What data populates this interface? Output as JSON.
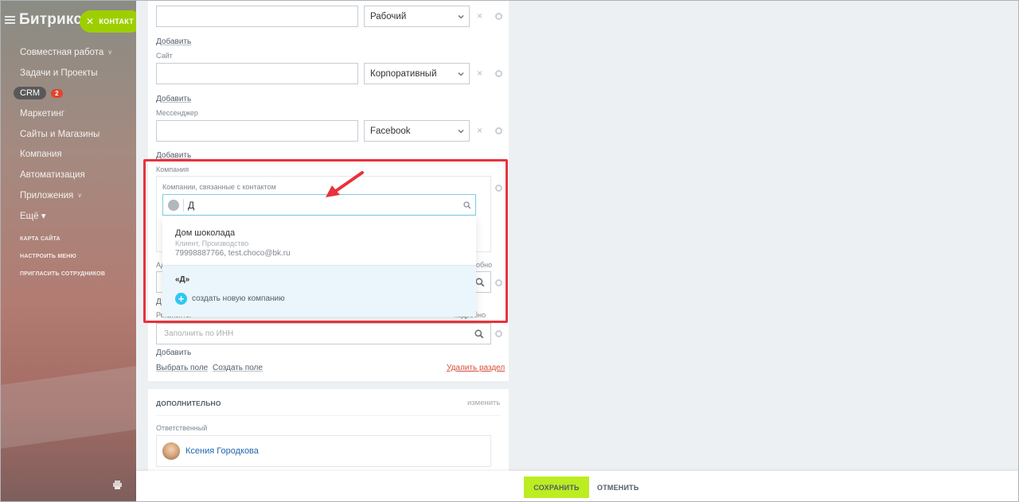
{
  "sidebar": {
    "logo": "Битрикс",
    "contact_pill": "КОНТАКТ",
    "items": [
      {
        "label": "Совместная работа",
        "chevron": true
      },
      {
        "label": "Задачи и Проекты"
      },
      {
        "label": "CRM",
        "badge": "2"
      },
      {
        "label": "Маркетинг"
      },
      {
        "label": "Сайты и Магазины"
      },
      {
        "label": "Компания"
      },
      {
        "label": "Автоматизация"
      },
      {
        "label": "Приложения",
        "chevron": true
      },
      {
        "label": "Ещё ▾"
      }
    ],
    "small_links": [
      "КАРТА САЙТА",
      "НАСТРОИТЬ МЕНЮ",
      "ПРИГЛАСИТЬ СОТРУДНИКОВ"
    ]
  },
  "form": {
    "email": {
      "type_value": "Рабочий",
      "add_link": "Добавить"
    },
    "site": {
      "label": "Сайт",
      "type_value": "Корпоративный",
      "add_link": "Добавить"
    },
    "messenger": {
      "label": "Мессенджер",
      "type_value": "Facebook",
      "add_link": "Добавить"
    },
    "company": {
      "section_label": "Компания",
      "field_label": "Компании, связанные с контактом",
      "search_value": "Д",
      "result_name": "Дом шоколада",
      "result_meta": "Клиент, Производство",
      "result_contacts": "79998887766, test.choco@bk.ru",
      "query_echo": "«Д»",
      "create_new": "создать новую компанию"
    },
    "address": {
      "label_partial": "Ад",
      "details_partial": "обно",
      "add_partial": "Д"
    },
    "requisites": {
      "label": "Реквизиты",
      "details": "подробно",
      "placeholder": "Заполнить по ИНН",
      "add_link": "Добавить"
    },
    "footer_links": {
      "choose_field": "Выбрать поле",
      "create_field": "Создать поле",
      "delete_section": "Удалить раздел"
    }
  },
  "additional": {
    "title": "ДОПОЛНИТЕЛЬНО",
    "edit_link": "изменить",
    "responsible_label": "Ответственный",
    "responsible_name": "Ксения Городкова"
  },
  "footer": {
    "save": "СОХРАНИТЬ",
    "cancel": "ОТМЕНИТЬ"
  },
  "colors": {
    "accent_green": "#bbed21",
    "highlight_red": "#e9323b",
    "link_blue": "#2067b0"
  }
}
